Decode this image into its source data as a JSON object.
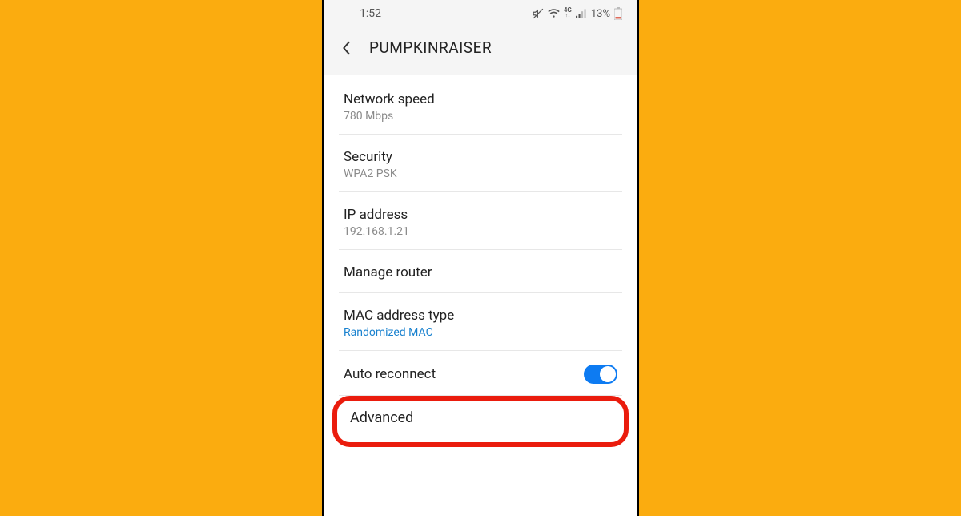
{
  "status": {
    "time": "1:52",
    "network_label": "4G",
    "battery_pct": "13%"
  },
  "header": {
    "title": "PUMPKINRAISER"
  },
  "items": {
    "network_speed": {
      "label": "Network speed",
      "value": "780 Mbps"
    },
    "security": {
      "label": "Security",
      "value": "WPA2 PSK"
    },
    "ip_address": {
      "label": "IP address",
      "value": "192.168.1.21"
    },
    "manage_router": {
      "label": "Manage router"
    },
    "mac_type": {
      "label": "MAC address type",
      "value": "Randomized MAC"
    },
    "auto_reconnect": {
      "label": "Auto reconnect",
      "enabled": true
    },
    "advanced": {
      "label": "Advanced"
    }
  }
}
